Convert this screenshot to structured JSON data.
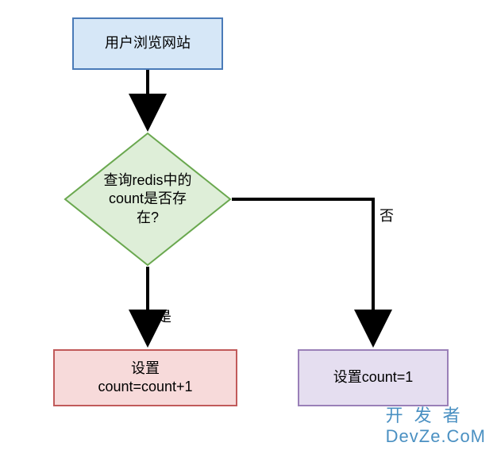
{
  "flow": {
    "start": {
      "label": "用户浏览网站"
    },
    "decision": {
      "label": "查询redis中的\ncount是否存\n在?"
    },
    "yes_label": "是",
    "no_label": "否",
    "result_yes": {
      "label": "设置\ncount=count+1"
    },
    "result_no": {
      "label": "设置count=1"
    }
  },
  "watermark": {
    "line1": "开发者",
    "line2": "DevZe.CoM"
  },
  "colors": {
    "start_fill": "#d6e7f7",
    "start_stroke": "#4a7bb8",
    "decision_fill": "#deeed8",
    "decision_stroke": "#6aa84f",
    "yes_fill": "#f7dada",
    "yes_stroke": "#c15a5a",
    "no_fill": "#e5def0",
    "no_stroke": "#9a80b8",
    "watermark": "#4a90c2"
  },
  "chart_data": {
    "type": "flowchart",
    "nodes": [
      {
        "id": "start",
        "kind": "process",
        "text": "用户浏览网站"
      },
      {
        "id": "check",
        "kind": "decision",
        "text": "查询redis中的count是否存在?"
      },
      {
        "id": "inc",
        "kind": "process",
        "text": "设置count=count+1"
      },
      {
        "id": "set1",
        "kind": "process",
        "text": "设置count=1"
      }
    ],
    "edges": [
      {
        "from": "start",
        "to": "check",
        "label": ""
      },
      {
        "from": "check",
        "to": "inc",
        "label": "是"
      },
      {
        "from": "check",
        "to": "set1",
        "label": "否"
      }
    ]
  }
}
